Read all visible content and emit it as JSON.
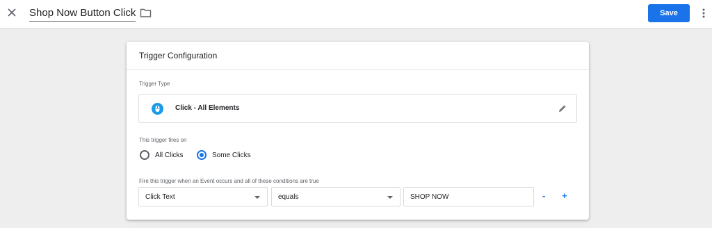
{
  "header": {
    "title": "Shop Now Button Click",
    "save_label": "Save"
  },
  "card": {
    "heading": "Trigger Configuration",
    "trigger_type_label": "Trigger Type",
    "trigger_type_value": "Click - All Elements",
    "fires_on_label": "This trigger fires on",
    "fires_on_options": [
      {
        "label": "All Clicks",
        "selected": false
      },
      {
        "label": "Some Clicks",
        "selected": true
      }
    ],
    "condition_label": "Fire this trigger when an Event occurs and all of these conditions are true",
    "condition": {
      "variable": "Click Text",
      "operator": "equals",
      "value": "SHOP NOW"
    },
    "remove_label": "-",
    "add_label": "+"
  },
  "colors": {
    "accent": "#1a73e8",
    "icon_blue": "#1a9be9"
  },
  "icons": [
    "close-icon",
    "folder-icon",
    "more-vert-icon",
    "mouse-icon",
    "pencil-icon",
    "chevron-down-icon"
  ]
}
